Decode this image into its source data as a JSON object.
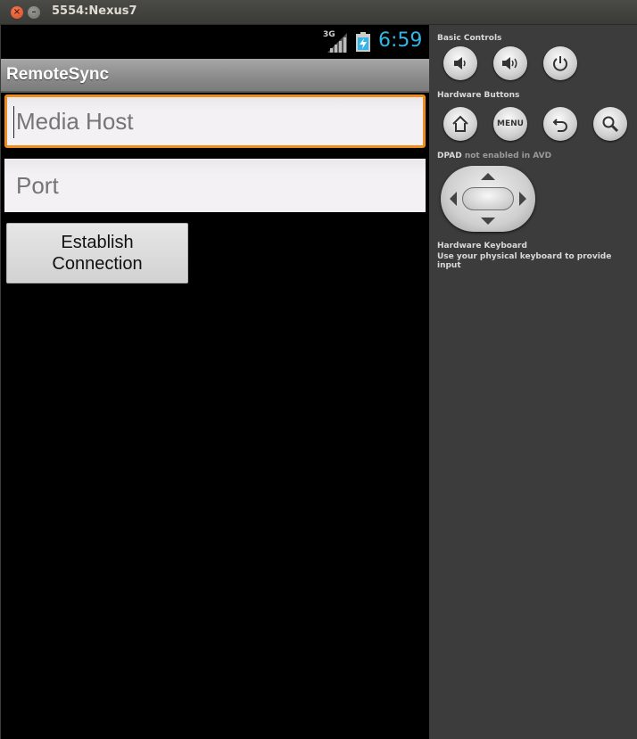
{
  "window": {
    "title": "5554:Nexus7",
    "close_glyph": "×",
    "minimize_glyph": "–"
  },
  "statusbar": {
    "network": "3G",
    "time": "6:59",
    "clock_color": "#33b5e5"
  },
  "app": {
    "title": "RemoteSync",
    "media_host": {
      "value": "",
      "placeholder": "Media Host"
    },
    "port": {
      "value": "",
      "placeholder": "Port"
    },
    "connect_label": "Establish\nConnection",
    "focus_color": "#ef8b1f"
  },
  "panel": {
    "basic_controls": "Basic Controls",
    "hardware_buttons": "Hardware Buttons",
    "menu_label": "MENU",
    "dpad_label": "DPAD",
    "dpad_note": "not enabled in AVD",
    "keyboard_title": "Hardware Keyboard",
    "keyboard_note": "Use your physical keyboard to provide input",
    "icons": [
      "volume-down-icon",
      "volume-up-icon",
      "power-icon",
      "home-icon",
      "menu-icon",
      "back-icon",
      "search-icon"
    ]
  }
}
